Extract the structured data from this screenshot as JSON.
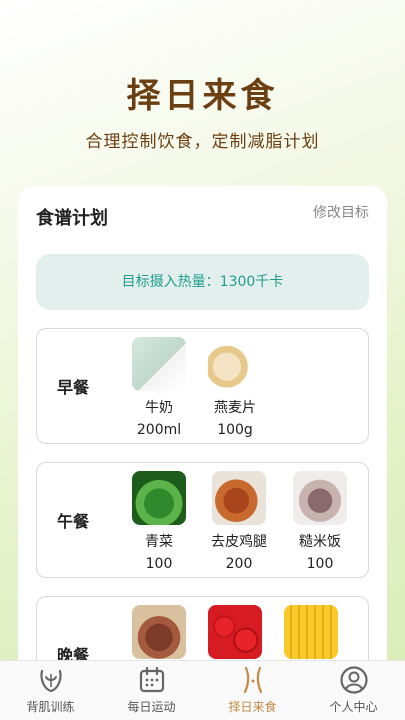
{
  "header": {
    "title": "择日来食",
    "subtitle": "合理控制饮食，定制减脂计划"
  },
  "card": {
    "title": "食谱计划",
    "action": "修改目标",
    "target_text": "目标摄入热量：1300千卡"
  },
  "meals": [
    {
      "label": "早餐",
      "foods": [
        {
          "name": "牛奶",
          "amount": "200ml",
          "image": "milk"
        },
        {
          "name": "燕麦片",
          "amount": "100g",
          "image": "oats"
        }
      ]
    },
    {
      "label": "午餐",
      "foods": [
        {
          "name": "青菜",
          "amount": "100",
          "image": "greens"
        },
        {
          "name": "去皮鸡腿",
          "amount": "200",
          "image": "chicken"
        },
        {
          "name": "糙米饭",
          "amount": "100",
          "image": "rice"
        }
      ]
    },
    {
      "label": "晚餐",
      "foods": [
        {
          "image": "ribs"
        },
        {
          "image": "tomato"
        },
        {
          "image": "corn"
        }
      ]
    }
  ],
  "tabs": [
    {
      "label": "背肌训练",
      "icon": "back-muscle-icon"
    },
    {
      "label": "每日运动",
      "icon": "calendar-icon"
    },
    {
      "label": "择日来食",
      "icon": "waist-icon",
      "active": true
    },
    {
      "label": "个人中心",
      "icon": "person-icon"
    }
  ],
  "colors": {
    "title": "#6b3f12",
    "target_text": "#1f9e8e",
    "tab_active": "#c58a44"
  }
}
